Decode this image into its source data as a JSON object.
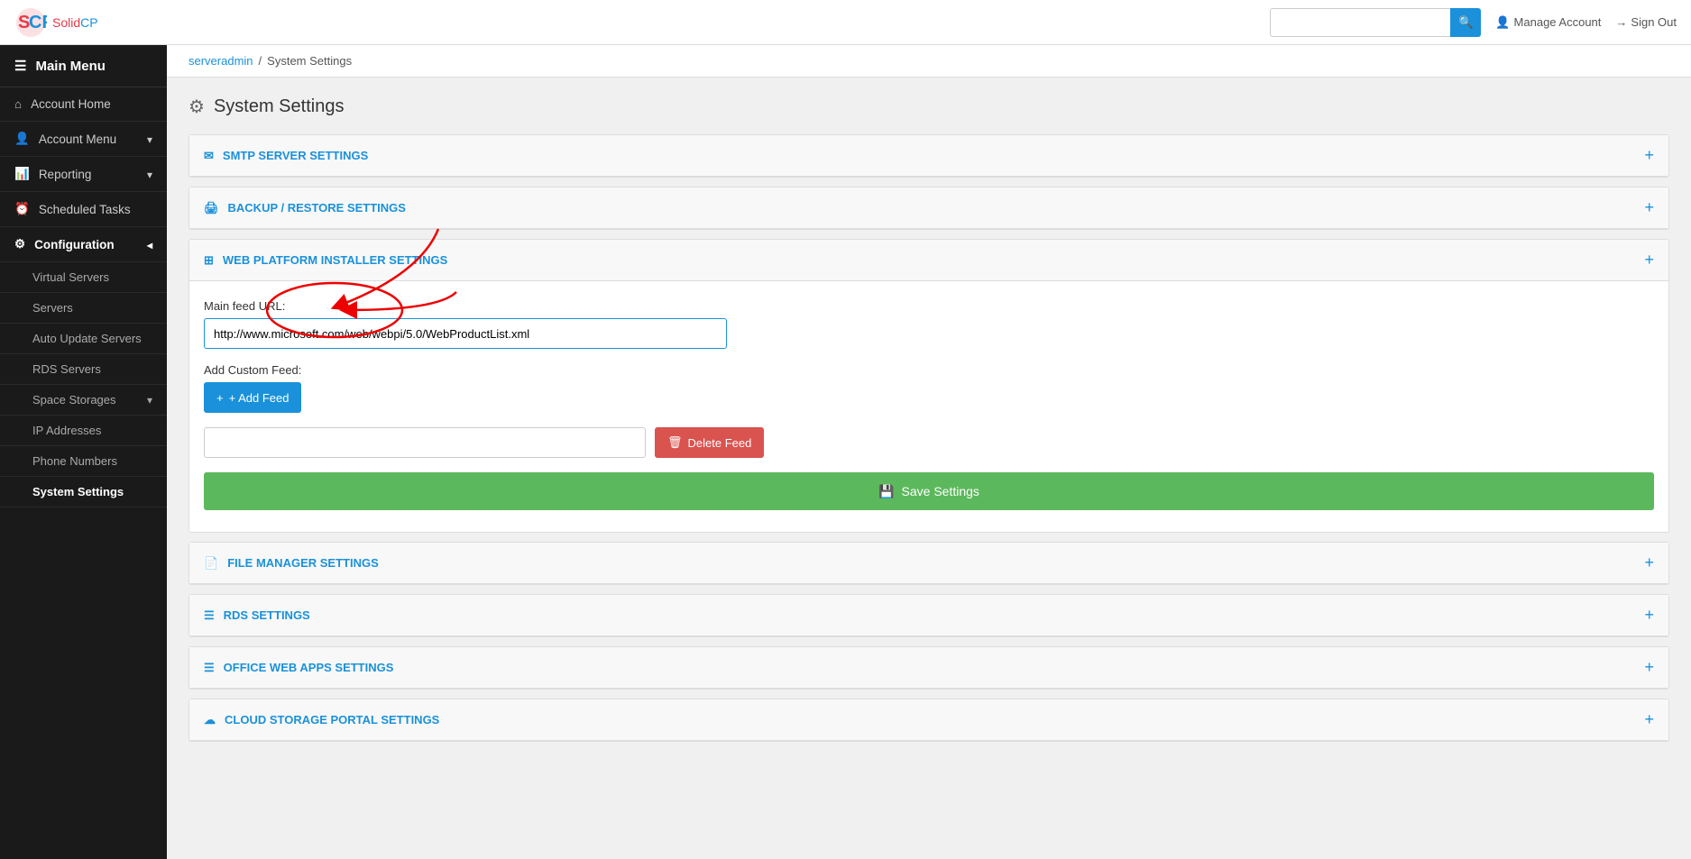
{
  "app": {
    "logo_solid": "Solid",
    "logo_cp": "CP"
  },
  "topnav": {
    "search_placeholder": "",
    "manage_account": "Manage Account",
    "sign_out": "Sign Out"
  },
  "sidebar": {
    "main_menu_label": "Main Menu",
    "items": [
      {
        "id": "account-home",
        "label": "Account Home",
        "icon": "home",
        "has_chevron": false,
        "active": false
      },
      {
        "id": "account-menu",
        "label": "Account Menu",
        "icon": "user",
        "has_chevron": true,
        "active": false
      },
      {
        "id": "reporting",
        "label": "Reporting",
        "icon": "chart",
        "has_chevron": true,
        "active": false
      },
      {
        "id": "scheduled-tasks",
        "label": "Scheduled Tasks",
        "icon": "clock",
        "has_chevron": false,
        "active": false
      },
      {
        "id": "configuration",
        "label": "Configuration",
        "icon": "config",
        "has_chevron": true,
        "active": true,
        "chevron_direction": "left"
      }
    ],
    "sub_items": [
      {
        "id": "virtual-servers",
        "label": "Virtual Servers",
        "active": false
      },
      {
        "id": "servers",
        "label": "Servers",
        "active": false
      },
      {
        "id": "auto-update-servers",
        "label": "Auto Update Servers",
        "active": false
      },
      {
        "id": "rds-servers",
        "label": "RDS Servers",
        "active": false
      },
      {
        "id": "space-storages",
        "label": "Space Storages",
        "active": false,
        "has_chevron": true
      },
      {
        "id": "ip-addresses",
        "label": "IP Addresses",
        "active": false
      },
      {
        "id": "phone-numbers",
        "label": "Phone Numbers",
        "active": false
      },
      {
        "id": "system-settings",
        "label": "System Settings",
        "active": true
      }
    ]
  },
  "breadcrumb": {
    "items": [
      {
        "label": "serveradmin",
        "link": true
      },
      {
        "label": "System Settings",
        "link": false
      }
    ]
  },
  "page": {
    "title": "System Settings",
    "sections": [
      {
        "id": "smtp",
        "icon": "email",
        "title": "SMTP SERVER SETTINGS",
        "expanded": false
      },
      {
        "id": "backup",
        "icon": "backup",
        "title": "BACKUP / RESTORE SETTINGS",
        "expanded": false
      },
      {
        "id": "webpi",
        "icon": "web",
        "title": "WEB PLATFORM INSTALLER SETTINGS",
        "expanded": true,
        "fields": {
          "main_feed_url_label": "Main feed URL:",
          "main_feed_url_value": "http://www.microsoft.com/web/webpi/5.0/WebProductList.xml",
          "add_custom_feed_label": "Add Custom Feed:",
          "add_feed_btn": "+ Add Feed",
          "custom_feed_placeholder": "",
          "delete_feed_btn": "Delete Feed",
          "save_settings_btn": "Save Settings"
        }
      },
      {
        "id": "filemanager",
        "icon": "file",
        "title": "FILE MANAGER SETTINGS",
        "expanded": false
      },
      {
        "id": "rds",
        "icon": "rds",
        "title": "RDS SETTINGS",
        "expanded": false
      },
      {
        "id": "officewebapps",
        "icon": "office",
        "title": "OFFICE WEB APPS SETTINGS",
        "expanded": false
      },
      {
        "id": "cloudstorage",
        "icon": "cloud",
        "title": "CLOUD STORAGE PORTAL SETTINGS",
        "expanded": false
      }
    ]
  }
}
